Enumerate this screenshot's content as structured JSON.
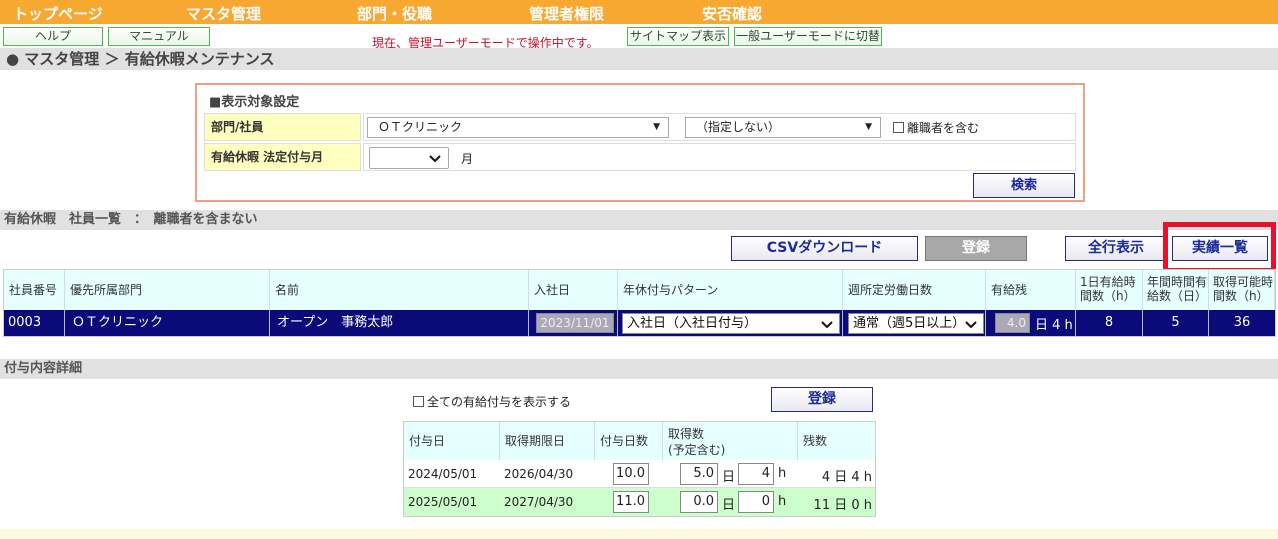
{
  "nav": {
    "items": [
      "トップページ",
      "マスタ管理",
      "部門・役職",
      "管理者権限",
      "安否確認"
    ]
  },
  "subbar": {
    "help": "ヘルプ",
    "manual": "マニュアル",
    "notice": "現在、管理ユーザーモードで操作中です。",
    "sitemap": "サイトマップ表示",
    "switch_mode": "一般ユーザーモードに切替"
  },
  "breadcrumb": "● マスタ管理 ＞ 有給休暇メンテナンス",
  "filter": {
    "title": "■表示対象設定",
    "dept_label": "部門/社員",
    "dept_value": "ＯＴクリニック",
    "emp_value": "（指定しない）",
    "include_retired": "離職者を含む",
    "grant_month_label": "有給休暇 法定付与月",
    "grant_month_value": "",
    "month_unit": "月",
    "search": "検索"
  },
  "list": {
    "title": "有給休暇　社員一覧　：　離職者を含まない",
    "csv_download": "CSVダウンロード",
    "register": "登録",
    "show_all": "全行表示",
    "results": "実績一覧",
    "headers": [
      "社員番号",
      "優先所属部門",
      "名前",
      "入社日",
      "年休付与パターン",
      "週所定労働日数",
      "有給残",
      "1日有給時間数（h）",
      "年間時間有給数（日）",
      "取得可能時間数（h）"
    ],
    "row": {
      "id": "0003",
      "dept": "ＯＴクリニック",
      "name": "オープン　事務太郎",
      "hire_date": "2023/11/01",
      "pattern": "入社日（入社日付与）",
      "weekly_days": "通常（週5日以上）",
      "remaining": "4.0",
      "remaining_unit": "日 4 h",
      "daily_hours": "8",
      "annual_days": "5",
      "available_hours": "36"
    }
  },
  "detail": {
    "title": "付与内容詳細",
    "show_all": "全ての有給付与を表示する",
    "register": "登録",
    "headers": [
      "付与日",
      "取得期限日",
      "付与日数",
      "取得数\n(予定含む)",
      "残数"
    ],
    "rows": [
      {
        "grant_date": "2024/05/01",
        "expiry": "2026/04/30",
        "days": "10.0",
        "taken_days": "5.0",
        "day_unit": "日",
        "taken_hours": "4",
        "hour_unit": "h",
        "remain": "4 日 4 h"
      },
      {
        "grant_date": "2025/05/01",
        "expiry": "2027/04/30",
        "days": "11.0",
        "taken_days": "0.0",
        "day_unit": "日",
        "taken_hours": "0",
        "hour_unit": "h",
        "remain": "11 日 0 h"
      }
    ]
  },
  "colors": {
    "nav": "#f7a830",
    "row_selected": "#0a0a7a",
    "header_bg": "#e6ffff",
    "label_bg": "#ffffc0",
    "highlight": "#e8102a"
  }
}
